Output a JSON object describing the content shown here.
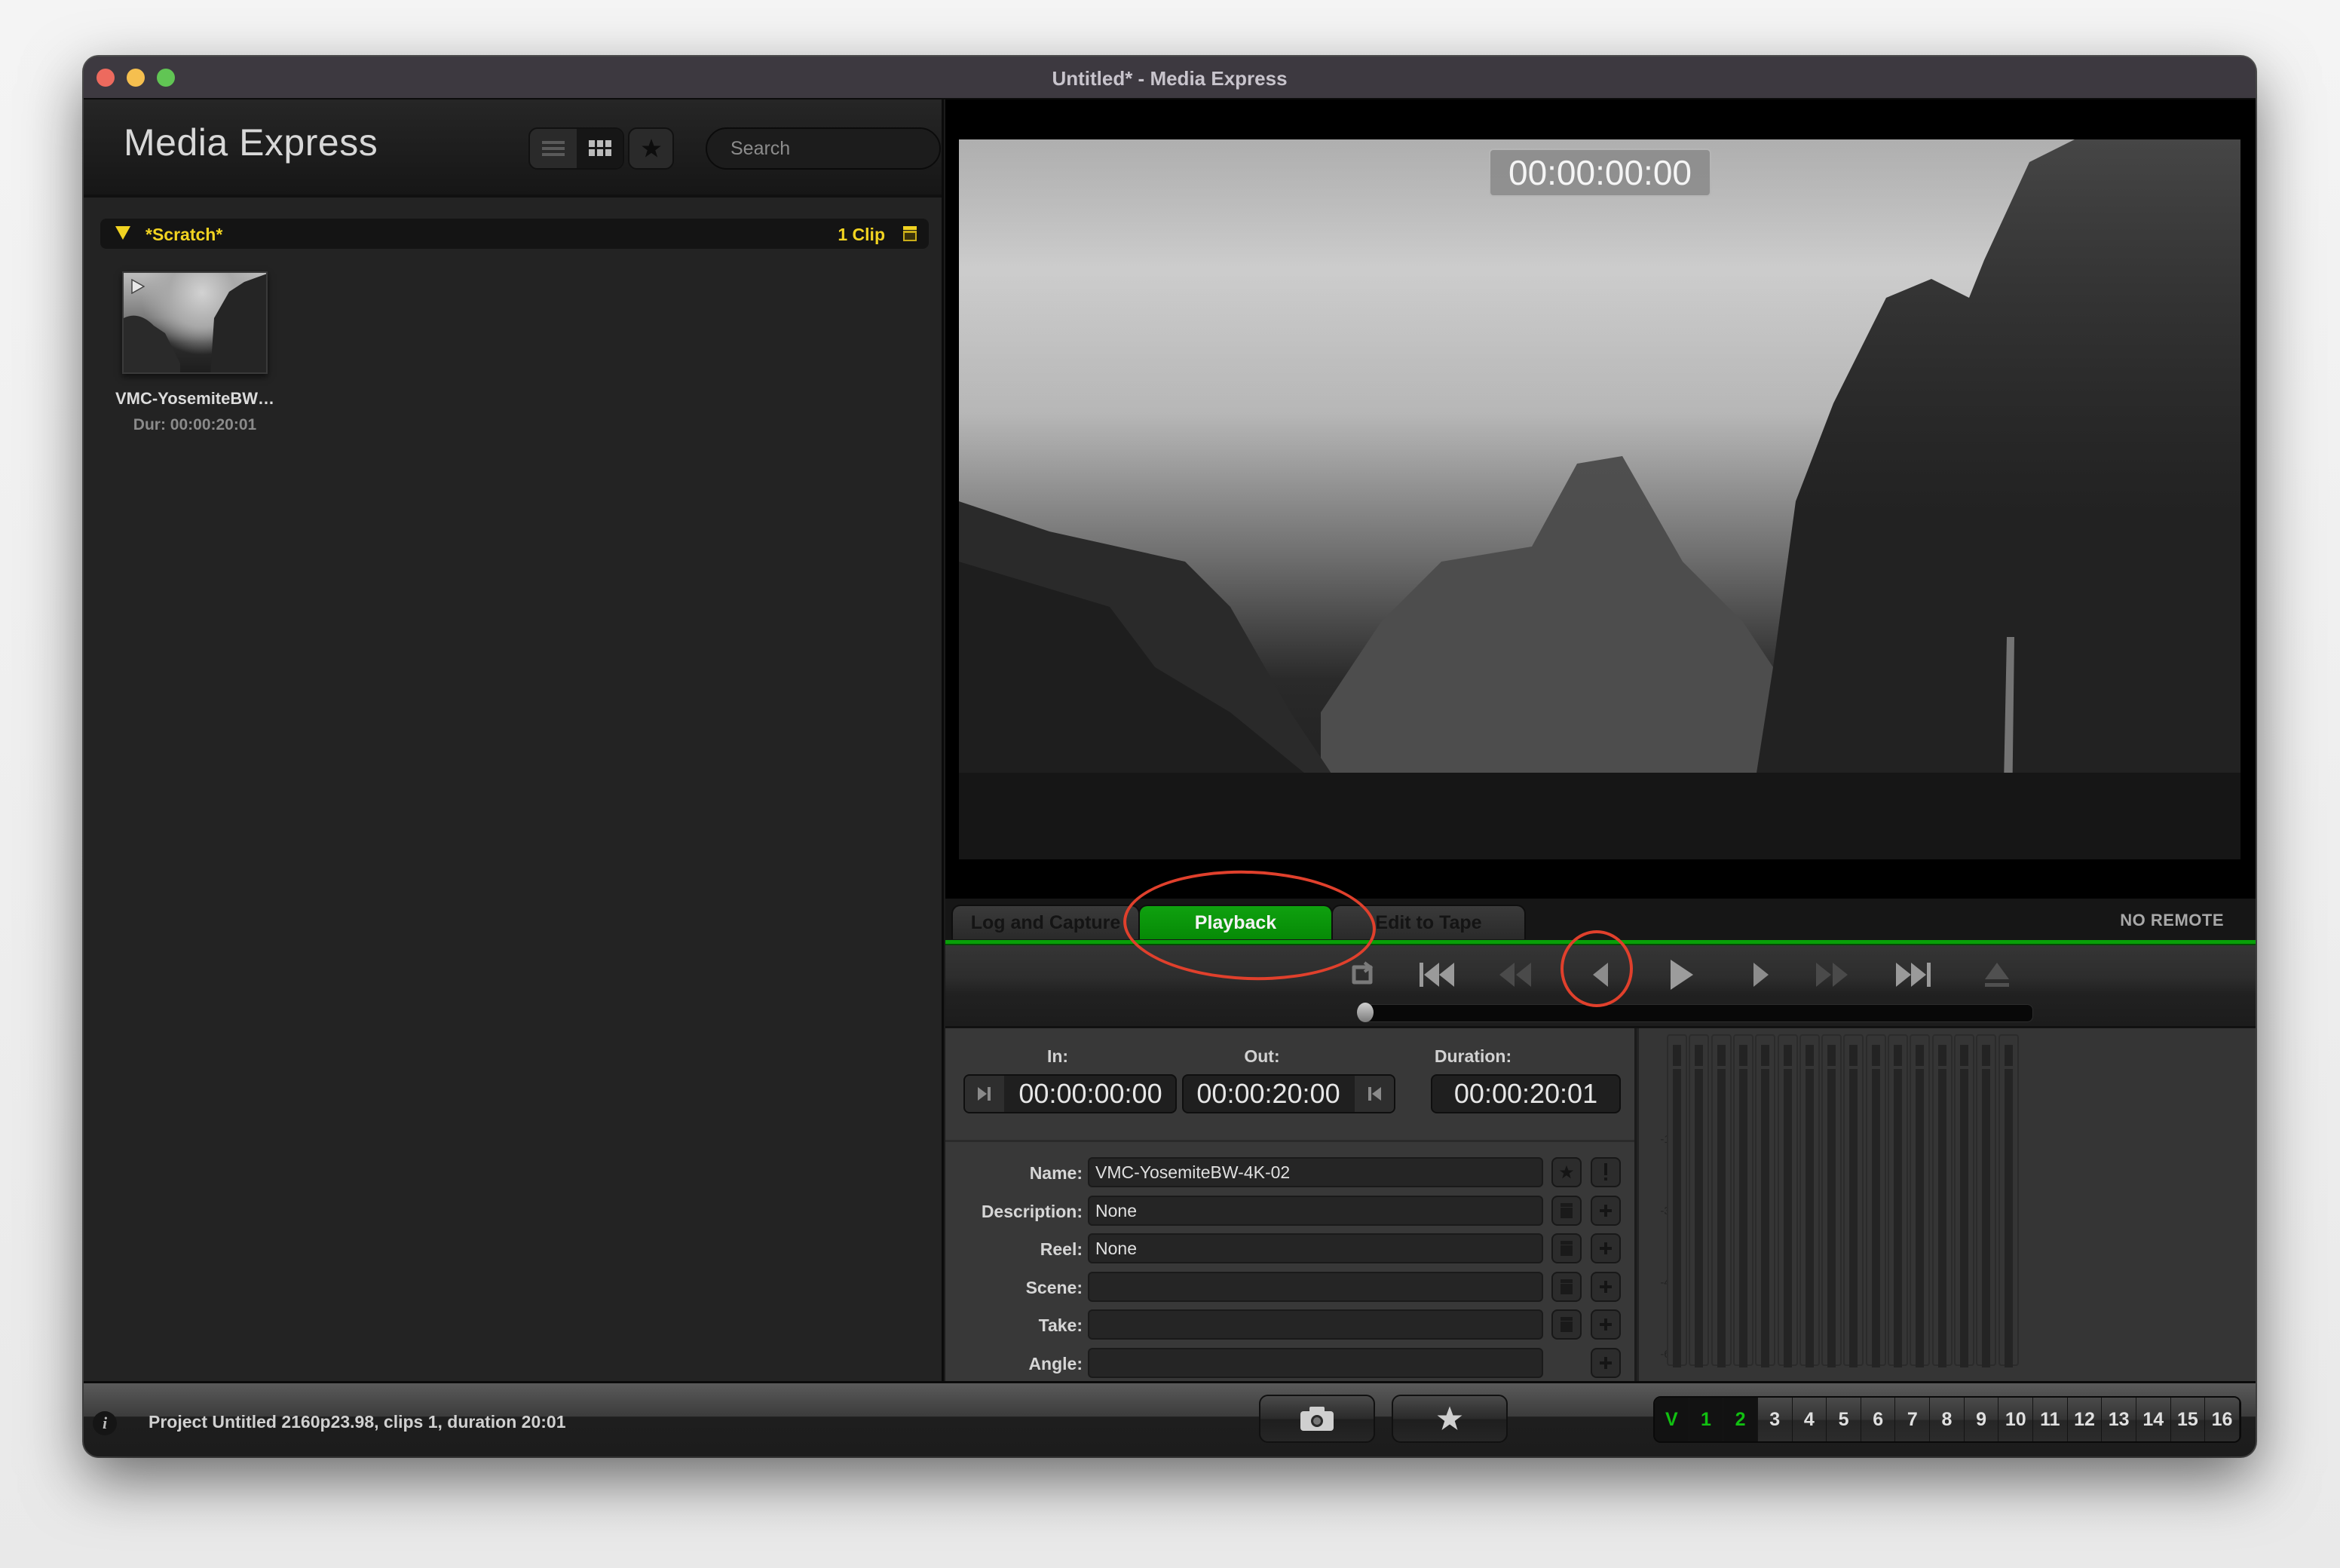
{
  "window": {
    "title": "Untitled* - Media Express",
    "traffic_lights": {
      "close": "#ed6a5e",
      "minimize": "#f5bf4f",
      "zoom": "#61c554"
    }
  },
  "library": {
    "app_name": "Media Express",
    "view_buttons": [
      {
        "name": "list-view",
        "icon": "list-icon",
        "active": false
      },
      {
        "name": "thumbnail-view",
        "icon": "grid-icon",
        "active": true
      }
    ],
    "favorites_icon": "star-icon",
    "search": {
      "placeholder": "Search",
      "value": ""
    },
    "bin": {
      "name": "*Scratch*",
      "count": "1 Clip",
      "icon": "clapper-icon",
      "expanded": true
    },
    "clips": [
      {
        "name": "VMC-YosemiteBW…",
        "duration": "Dur: 00:00:20:01"
      }
    ]
  },
  "viewer": {
    "timecode": "00:00:00:00"
  },
  "tabs": [
    {
      "label": "Log and Capture",
      "active": false
    },
    {
      "label": "Playback",
      "active": true
    },
    {
      "label": "Edit to Tape",
      "active": false
    }
  ],
  "remote_status": "NO REMOTE",
  "transport": {
    "buttons": [
      "loop",
      "go-to-start",
      "rewind",
      "step-back",
      "play",
      "step-forward",
      "fast-forward",
      "go-to-end",
      "eject"
    ],
    "scrub_position": 0
  },
  "inout": {
    "in_label": "In:",
    "in_value": "00:00:00:00",
    "out_label": "Out:",
    "out_value": "00:00:20:00",
    "duration_label": "Duration:",
    "duration_value": "00:00:20:01"
  },
  "metadata": [
    {
      "label": "Name:",
      "value": "VMC-YosemiteBW-4K-02",
      "buttons": [
        "star",
        "!"
      ]
    },
    {
      "label": "Description:",
      "value": "None",
      "buttons": [
        "clapper",
        "+"
      ]
    },
    {
      "label": "Reel:",
      "value": "None",
      "buttons": [
        "clapper",
        "+"
      ]
    },
    {
      "label": "Scene:",
      "value": "",
      "buttons": [
        "clapper",
        "+"
      ]
    },
    {
      "label": "Take:",
      "value": "",
      "buttons": [
        "clapper",
        "+"
      ]
    },
    {
      "label": "Angle:",
      "value": "",
      "buttons": [
        "+"
      ]
    }
  ],
  "audio_meters": {
    "scale": [
      "-0",
      "-15",
      "-30",
      "-45",
      "-60"
    ],
    "channels": 16
  },
  "status": {
    "text": "Project Untitled  2160p23.98, clips 1, duration 20:01",
    "channels": [
      {
        "label": "V",
        "on": true
      },
      {
        "label": "1",
        "on": true
      },
      {
        "label": "2",
        "on": true
      },
      {
        "label": "3",
        "on": false
      },
      {
        "label": "4",
        "on": false
      },
      {
        "label": "5",
        "on": false
      },
      {
        "label": "6",
        "on": false
      },
      {
        "label": "7",
        "on": false
      },
      {
        "label": "8",
        "on": false
      },
      {
        "label": "9",
        "on": false
      },
      {
        "label": "10",
        "on": false
      },
      {
        "label": "11",
        "on": false
      },
      {
        "label": "12",
        "on": false
      },
      {
        "label": "13",
        "on": false
      },
      {
        "label": "14",
        "on": false
      },
      {
        "label": "15",
        "on": false
      },
      {
        "label": "16",
        "on": false
      }
    ]
  },
  "annotations": [
    {
      "target": "playback-tab",
      "color": "#e0402c"
    },
    {
      "target": "play-button",
      "color": "#e0402c"
    }
  ]
}
